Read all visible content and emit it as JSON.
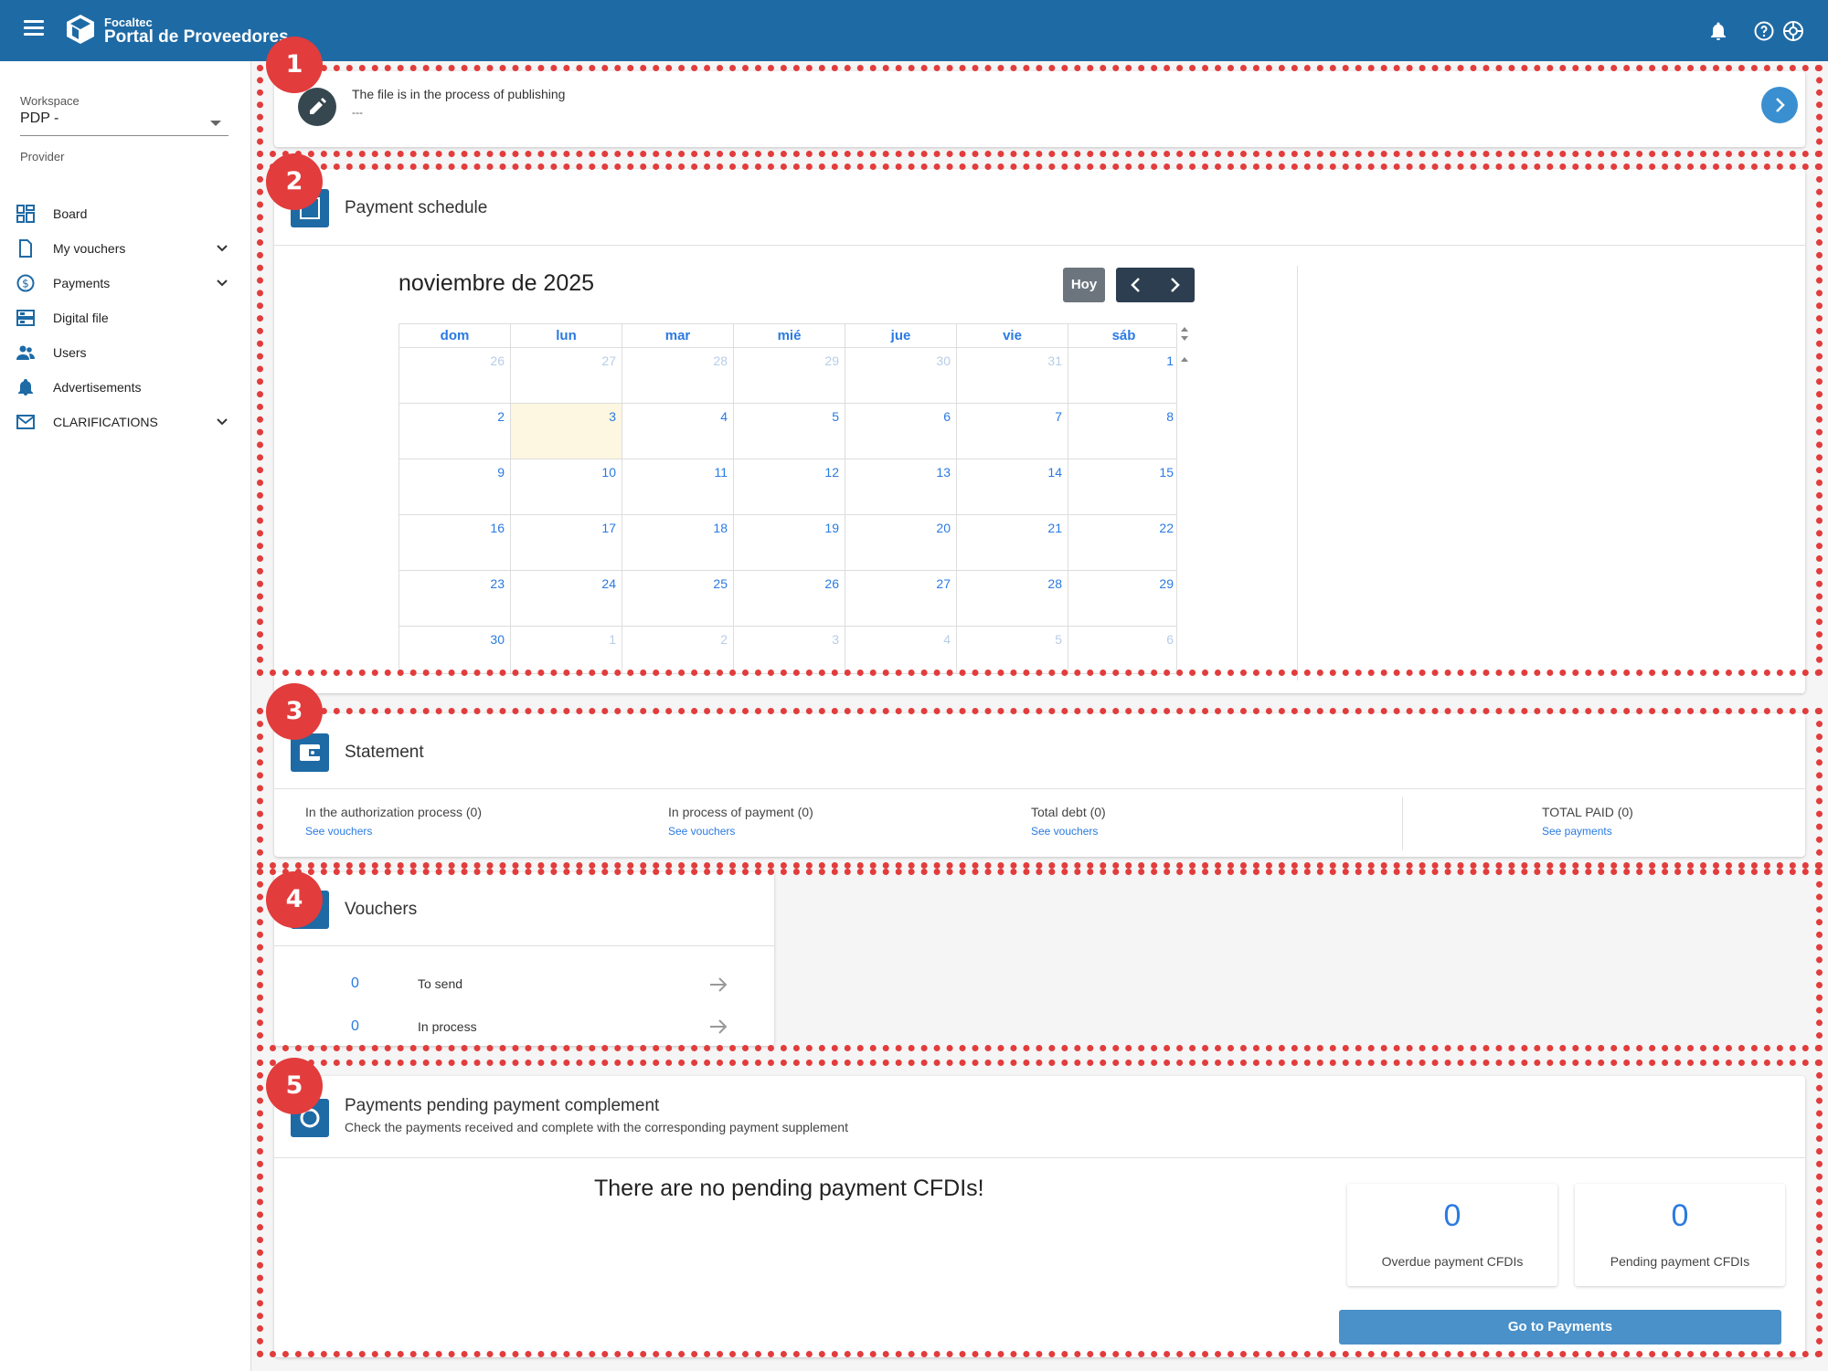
{
  "topbar": {
    "brand_small": "Focaltec",
    "brand_big": "Portal de Proveedores",
    "icons": [
      "menu-icon",
      "logo-cube-icon",
      "bell-icon",
      "help-icon",
      "settings-icon"
    ]
  },
  "sidebar": {
    "workspace_label": "Workspace",
    "workspace_value": "PDP -",
    "provider_label": "Provider",
    "items": [
      {
        "label": "Board",
        "icon": "board-icon",
        "expandable": false
      },
      {
        "label": "My vouchers",
        "icon": "document-icon",
        "expandable": true
      },
      {
        "label": "Payments",
        "icon": "dollar-icon",
        "expandable": true
      },
      {
        "label": "Digital file",
        "icon": "digital-file-icon",
        "expandable": false
      },
      {
        "label": "Users",
        "icon": "users-icon",
        "expandable": false
      },
      {
        "label": "Advertisements",
        "icon": "bell-icon",
        "expandable": false
      },
      {
        "label": "CLARIFICATIONS",
        "icon": "mail-icon",
        "expandable": true
      }
    ]
  },
  "badges": [
    "1",
    "2",
    "3",
    "4",
    "5"
  ],
  "file_status": {
    "title": "The file is in the process of publishing",
    "subtitle": "---"
  },
  "payment_schedule": {
    "title": "Payment schedule",
    "month_title": "noviembre de 2025",
    "today_button": "Hoy",
    "weekdays": [
      "dom",
      "lun",
      "mar",
      "mié",
      "jue",
      "vie",
      "sáb"
    ],
    "weeks": [
      [
        {
          "d": "26",
          "o": true
        },
        {
          "d": "27",
          "o": true
        },
        {
          "d": "28",
          "o": true
        },
        {
          "d": "29",
          "o": true
        },
        {
          "d": "30",
          "o": true
        },
        {
          "d": "31",
          "o": true
        },
        {
          "d": "1",
          "o": false
        }
      ],
      [
        {
          "d": "2",
          "o": false
        },
        {
          "d": "3",
          "o": false,
          "today": true
        },
        {
          "d": "4",
          "o": false
        },
        {
          "d": "5",
          "o": false
        },
        {
          "d": "6",
          "o": false
        },
        {
          "d": "7",
          "o": false
        },
        {
          "d": "8",
          "o": false
        }
      ],
      [
        {
          "d": "9",
          "o": false
        },
        {
          "d": "10",
          "o": false
        },
        {
          "d": "11",
          "o": false
        },
        {
          "d": "12",
          "o": false
        },
        {
          "d": "13",
          "o": false
        },
        {
          "d": "14",
          "o": false
        },
        {
          "d": "15",
          "o": false
        }
      ],
      [
        {
          "d": "16",
          "o": false
        },
        {
          "d": "17",
          "o": false
        },
        {
          "d": "18",
          "o": false
        },
        {
          "d": "19",
          "o": false
        },
        {
          "d": "20",
          "o": false
        },
        {
          "d": "21",
          "o": false
        },
        {
          "d": "22",
          "o": false
        }
      ],
      [
        {
          "d": "23",
          "o": false
        },
        {
          "d": "24",
          "o": false
        },
        {
          "d": "25",
          "o": false
        },
        {
          "d": "26",
          "o": false
        },
        {
          "d": "27",
          "o": false
        },
        {
          "d": "28",
          "o": false
        },
        {
          "d": "29",
          "o": false
        }
      ],
      [
        {
          "d": "30",
          "o": false
        },
        {
          "d": "1",
          "o": true
        },
        {
          "d": "2",
          "o": true
        },
        {
          "d": "3",
          "o": true
        },
        {
          "d": "4",
          "o": true
        },
        {
          "d": "5",
          "o": true
        },
        {
          "d": "6",
          "o": true
        }
      ]
    ]
  },
  "statement": {
    "title": "Statement",
    "items": [
      {
        "label": "In the authorization process (0)",
        "link": "See vouchers"
      },
      {
        "label": "In process of payment (0)",
        "link": "See vouchers"
      },
      {
        "label": "Total debt (0)",
        "link": "See vouchers"
      },
      {
        "label": "TOTAL PAID (0)",
        "link": "See payments"
      }
    ]
  },
  "vouchers": {
    "title": "Vouchers",
    "rows": [
      {
        "count": "0",
        "label": "To send"
      },
      {
        "count": "0",
        "label": "In process"
      }
    ]
  },
  "pending_complement": {
    "title": "Payments pending payment complement",
    "subtitle": "Check the payments received and complete with the corresponding payment supplement",
    "empty_message": "There are no pending payment CFDIs!",
    "stats": [
      {
        "value": "0",
        "label": "Overdue payment CFDIs"
      },
      {
        "value": "0",
        "label": "Pending payment CFDIs"
      }
    ],
    "button": "Go to Payments"
  },
  "colors": {
    "primary": "#1e6aa5",
    "accent_blue": "#2a7ae2",
    "annotation_red": "#e23c3c",
    "today_bg": "#fdf6e0"
  }
}
